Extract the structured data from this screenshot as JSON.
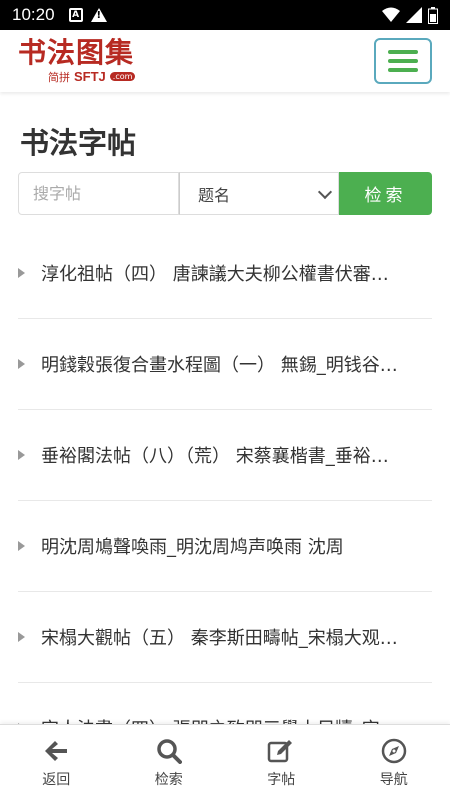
{
  "status_bar": {
    "time": "10:20",
    "notif_letter": "A"
  },
  "header": {
    "logo_title": "书法图集",
    "logo_sub_cn": "简拼",
    "logo_sub_en": "SFTJ",
    "logo_sub_com": ".com"
  },
  "page": {
    "title": "书法字帖"
  },
  "search": {
    "placeholder": "搜字帖",
    "select_value": "题名",
    "button_label": "检索"
  },
  "list_items": [
    "淳化祖帖（四） 唐諫議大夫柳公權書伏審…",
    "明錢穀張復合畫水程圖（一） 無錫_明钱谷…",
    "垂裕閣法帖（八）（荒） 宋蔡襄楷書_垂裕…",
    "明沈周鳩聲喚雨_明沈周鸠声唤雨 沈周",
    "宋榻大觀帖（五） 秦李斯田疇帖_宋榻大观…",
    "宋人法書（四） 張即之致即三學士尺牘_宋…"
  ],
  "bottom_nav": {
    "back": "返回",
    "search": "检索",
    "copybook": "字帖",
    "navigate": "导航"
  },
  "colors": {
    "brand_red": "#b72a22",
    "accent_green": "#4caf50",
    "menu_border": "#5aa9bd"
  },
  "icons": {
    "back": "arrow-left-icon",
    "search": "search-icon",
    "copybook": "edit-icon",
    "navigate": "compass-icon"
  }
}
